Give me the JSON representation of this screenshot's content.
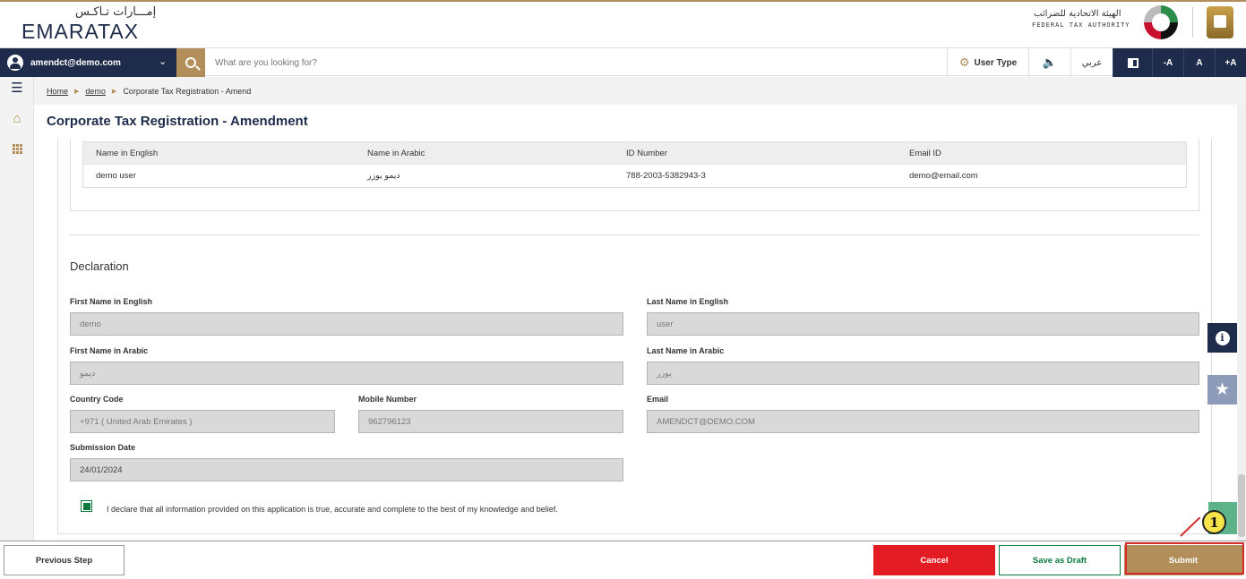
{
  "brand": {
    "logo_ar": "إمـــارات تـاكـس",
    "logo_en": "EMARATAX",
    "authority_ar": "الهيئة الاتحادية للضرائب",
    "authority_en": "FEDERAL TAX AUTHORITY"
  },
  "nav": {
    "user_email": "amendct@demo.com",
    "search_placeholder": "What are you looking for?",
    "user_type": "User Type",
    "language": "عربي",
    "font_decrease": "-A",
    "font_normal": "A",
    "font_increase": "+A"
  },
  "breadcrumb": {
    "items": [
      "Home",
      "demo",
      "Corporate Tax Registration - Amend"
    ]
  },
  "page": {
    "title": "Corporate Tax Registration - Amendment"
  },
  "table": {
    "headers": [
      "Name in English",
      "Name in Arabic",
      "ID Number",
      "Email ID"
    ],
    "rows": [
      [
        "demo user",
        "ديمو يوزر",
        "788-2003-5382943-3",
        "demo@email.com"
      ]
    ]
  },
  "declaration": {
    "title": "Declaration",
    "first_name_en_label": "First Name in English",
    "first_name_en": "demo",
    "last_name_en_label": "Last Name in English",
    "last_name_en": "user",
    "first_name_ar_label": "First Name in Arabic",
    "first_name_ar": "ديمو",
    "last_name_ar_label": "Last Name in Arabic",
    "last_name_ar": "يوزر",
    "country_code_label": "Country Code",
    "country_code": "+971 ( United Arab Emirates )",
    "mobile_label": "Mobile Number",
    "mobile": "962796123",
    "email_label": "Email",
    "email": "AMENDCT@DEMO.COM",
    "submission_date_label": "Submission Date",
    "submission_date": "24/01/2024",
    "declaration_text": "I declare that all information provided on this application is true, accurate and complete to the best of my knowledge and belief.",
    "declaration_checked": true
  },
  "footer": {
    "previous": "Previous Step",
    "cancel": "Cancel",
    "save_draft": "Save as Draft",
    "submit": "Submit"
  },
  "annotation": {
    "callout_number": "1"
  },
  "colors": {
    "navy": "#1e2b4a",
    "gold": "#b28f5a",
    "red": "#e31b23",
    "green": "#0b7a3e"
  }
}
